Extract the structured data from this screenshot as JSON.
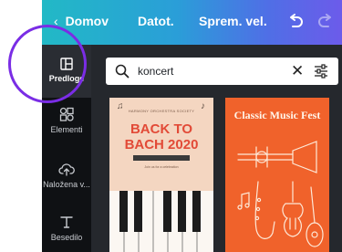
{
  "topbar": {
    "back_label": "Domov",
    "file_label": "Datot.",
    "resize_label": "Sprem. vel."
  },
  "sidebar": {
    "items": [
      {
        "label": "Predloge",
        "icon": "templates-icon",
        "active": true
      },
      {
        "label": "Elementi",
        "icon": "elements-icon"
      },
      {
        "label": "Naložena v...",
        "icon": "cloud-upload-icon"
      },
      {
        "label": "Besedilo",
        "icon": "text-icon"
      }
    ]
  },
  "search": {
    "value": "koncert",
    "icon": "search-icon"
  },
  "templates": [
    {
      "small_text": "HARMONY ORCHESTRA SOCIETY",
      "title_line1": "BACK TO",
      "title_line2": "BACH 2020",
      "sub_text": "Join us for a celebration",
      "colors": {
        "background": "#f4d6c1",
        "title": "#e24a37"
      }
    },
    {
      "title": "Classic Music Fest",
      "colors": {
        "background": "#f0622b",
        "title": "#fff5ea"
      }
    }
  ],
  "colors": {
    "sidebar_bg": "#0f1114",
    "content_bg": "#25282d",
    "highlight_ring": "#7a2de5"
  }
}
